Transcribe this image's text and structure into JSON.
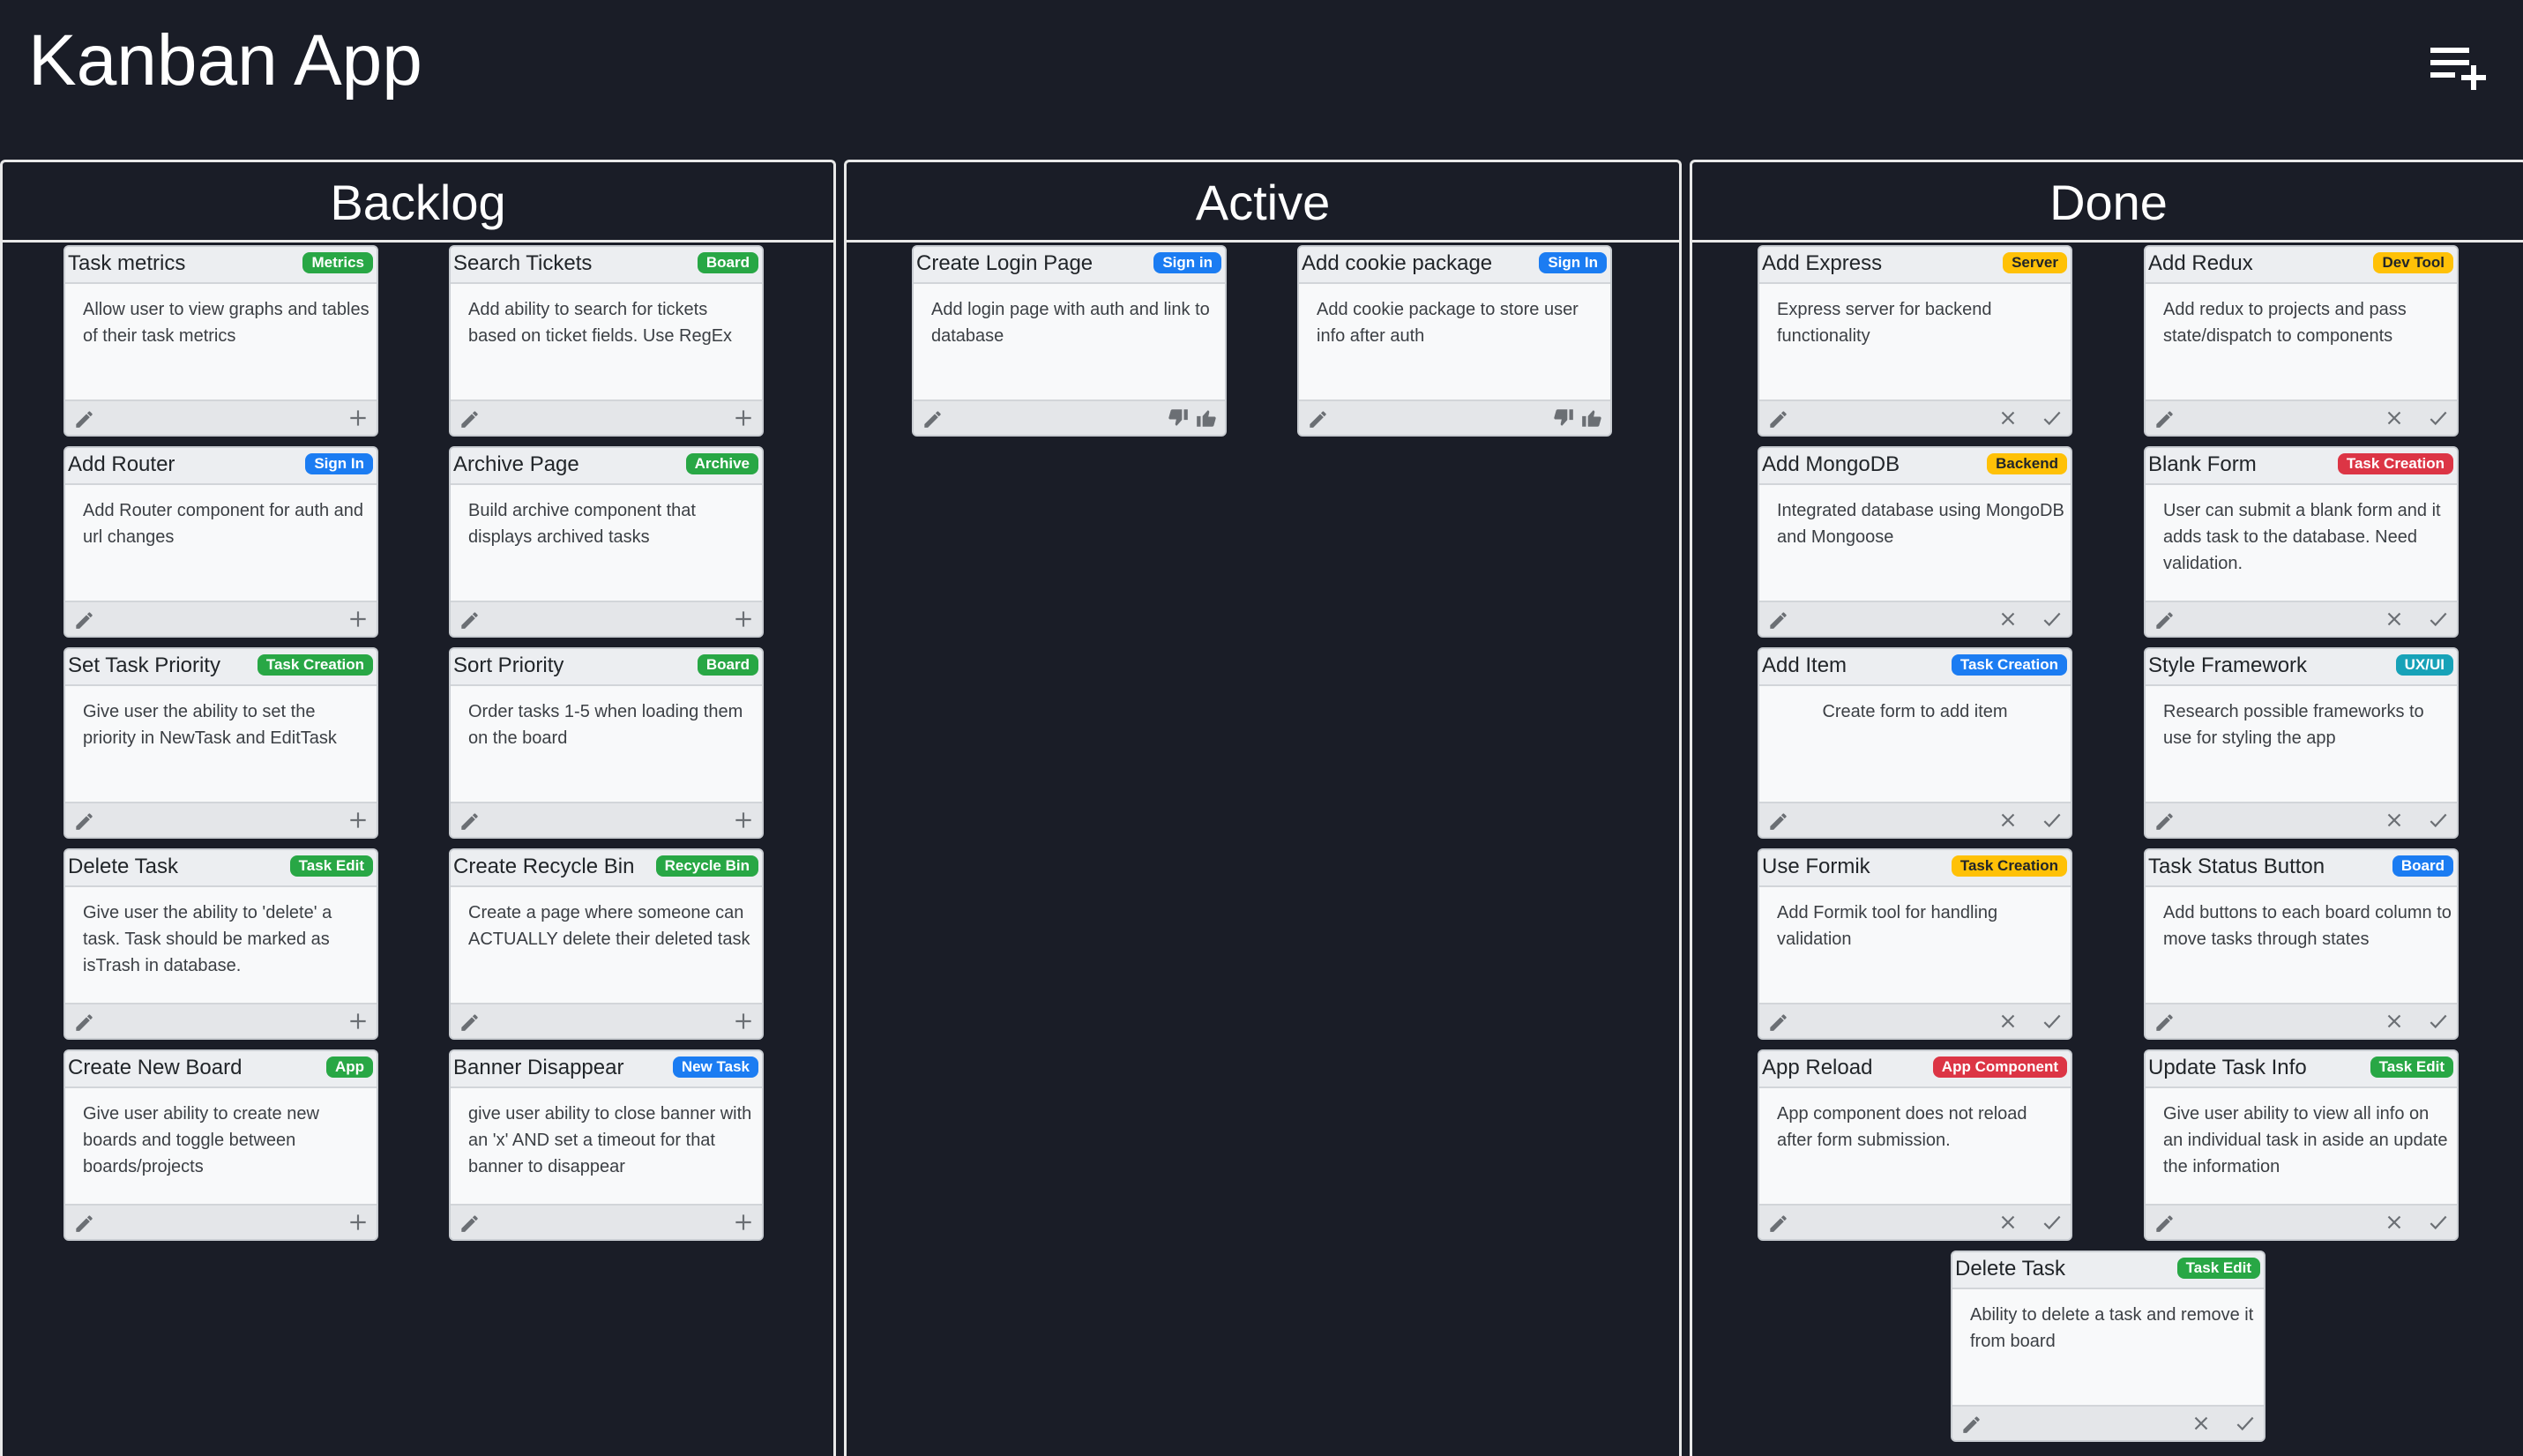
{
  "app": {
    "title": "Kanban App"
  },
  "colors": {
    "background": "#1a1d27",
    "border": "#e8e8e8",
    "green": "#28a745",
    "blue": "#1b7cf2",
    "yellow": "#ffc107",
    "red": "#dc3545",
    "teal": "#17a2b8"
  },
  "icons": {
    "add_board": "playlist-add-icon",
    "edit": "pencil-icon",
    "add": "plus-icon",
    "thumbs_down": "thumbs-down-icon",
    "thumbs_up": "thumbs-up-icon",
    "reject": "x-icon",
    "approve": "check-icon"
  },
  "columns": [
    {
      "title": "Backlog",
      "cards": [
        {
          "title": "Task metrics",
          "tag": "Metrics",
          "tag_color": "green",
          "body": "Allow user to view graphs and tables of their task metrics"
        },
        {
          "title": "Search Tickets",
          "tag": "Board",
          "tag_color": "green",
          "body": "Add ability to search for tickets based on ticket fields. Use RegEx"
        },
        {
          "title": "Add Router",
          "tag": "Sign In",
          "tag_color": "blue",
          "body": "Add Router component for auth and url changes"
        },
        {
          "title": "Archive Page",
          "tag": "Archive",
          "tag_color": "green",
          "body": "Build archive component that displays archived tasks"
        },
        {
          "title": "Set Task Priority",
          "tag": "Task Creation",
          "tag_color": "green",
          "body": "Give user the ability to set the priority in NewTask and EditTask"
        },
        {
          "title": "Sort Priority",
          "tag": "Board",
          "tag_color": "green",
          "body": "Order tasks 1-5 when loading them on the board"
        },
        {
          "title": "Delete Task",
          "tag": "Task Edit",
          "tag_color": "green",
          "body": "Give user the ability to 'delete' a task. Task should be marked as isTrash in database."
        },
        {
          "title": "Create Recycle Bin",
          "tag": "Recycle Bin",
          "tag_color": "green",
          "body": "Create a page where someone can ACTUALLY delete their deleted task"
        },
        {
          "title": "Create New Board",
          "tag": "App",
          "tag_color": "green",
          "body": "Give user ability to create new boards and toggle between boards/projects"
        },
        {
          "title": "Banner Disappear",
          "tag": "New Task",
          "tag_color": "blue",
          "body": "give user ability to close banner with an 'x' AND set a timeout for that banner to disappear"
        }
      ]
    },
    {
      "title": "Active",
      "cards": [
        {
          "title": "Create Login Page",
          "tag": "Sign in",
          "tag_color": "blue",
          "body": "Add login page with auth and link to database"
        },
        {
          "title": "Add cookie package",
          "tag": "Sign In",
          "tag_color": "blue",
          "body": "Add cookie package to store user info after auth"
        }
      ]
    },
    {
      "title": "Done",
      "cards": [
        {
          "title": "Add Express",
          "tag": "Server",
          "tag_color": "yellow",
          "body": "Express server for backend functionality"
        },
        {
          "title": "Add Redux",
          "tag": "Dev Tool",
          "tag_color": "yellow",
          "body": "Add redux to projects and pass state/dispatch to components"
        },
        {
          "title": "Add MongoDB",
          "tag": "Backend",
          "tag_color": "yellow",
          "body": "Integrated database using MongoDB and Mongoose"
        },
        {
          "title": "Blank Form",
          "tag": "Task Creation",
          "tag_color": "red",
          "body": "User can submit a blank form and it adds task to the database. Need validation."
        },
        {
          "title": "Add Item",
          "tag": "Task Creation",
          "tag_color": "blue",
          "body": "Create form to add item"
        },
        {
          "title": "Style Framework",
          "tag": "UX/UI",
          "tag_color": "teal",
          "body": "Research possible frameworks to use for styling the app"
        },
        {
          "title": "Use Formik",
          "tag": "Task Creation",
          "tag_color": "yellow",
          "body": "Add Formik tool for handling validation"
        },
        {
          "title": "Task Status Button",
          "tag": "Board",
          "tag_color": "blue",
          "body": "Add buttons to each board column to move tasks through states"
        },
        {
          "title": "App Reload",
          "tag": "App Component",
          "tag_color": "red",
          "body": "App component does not reload after form submission."
        },
        {
          "title": "Update Task Info",
          "tag": "Task Edit",
          "tag_color": "green",
          "body": "Give user ability to view all info on an individual task in aside an update the information"
        },
        {
          "title": "Delete Task",
          "tag": "Task Edit",
          "tag_color": "green",
          "body": "Ability to delete a task and remove it from board"
        }
      ]
    }
  ]
}
